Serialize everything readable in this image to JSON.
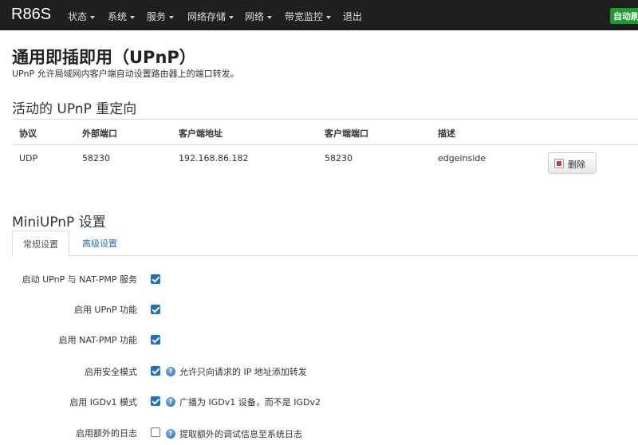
{
  "navbar": {
    "brand": "R86S",
    "items": [
      {
        "label": "状态",
        "dropdown": true
      },
      {
        "label": "系统",
        "dropdown": true
      },
      {
        "label": "服务",
        "dropdown": true
      },
      {
        "label": "网络存储",
        "dropdown": true
      },
      {
        "label": "网络",
        "dropdown": true
      },
      {
        "label": "带宽监控",
        "dropdown": true
      },
      {
        "label": "退出",
        "dropdown": false
      }
    ],
    "autorefresh": "自动刷新"
  },
  "page": {
    "title": "通用即插即用（UPnP）",
    "description": "UPnP 允许局域网内客户端自动设置路由器上的端口转发。"
  },
  "redirects": {
    "title": "活动的 UPnP 重定向",
    "columns": [
      "协议",
      "外部端口",
      "客户端地址",
      "客户端端口",
      "描述"
    ],
    "rows": [
      {
        "protocol": "UDP",
        "external_port": "58230",
        "client_address": "192.168.86.182",
        "client_port": "58230",
        "description": "edgeinside",
        "delete_label": "删除"
      }
    ]
  },
  "settings": {
    "title": "MiniUPnP 设置",
    "tabs": [
      {
        "label": "常规设置",
        "active": true
      },
      {
        "label": "高级设置",
        "active": false
      }
    ],
    "fields": [
      {
        "label": "启动 UPnP 与 NAT-PMP 服务",
        "checked": true,
        "help": ""
      },
      {
        "label": "启用 UPnP 功能",
        "checked": true,
        "help": ""
      },
      {
        "label": "启用 NAT-PMP 功能",
        "checked": true,
        "help": ""
      },
      {
        "label": "启用安全模式",
        "checked": true,
        "help": "允许只向请求的 IP 地址添加转发"
      },
      {
        "label": "启用 IGDv1 模式",
        "checked": true,
        "help": "广播为 IGDv1 设备，而不是 IGDv2"
      },
      {
        "label": "启用额外的日志",
        "checked": false,
        "help": "提取额外的调试信息至系统日志"
      }
    ]
  },
  "colors": {
    "navbar_bg": "#1f1f1f",
    "accent": "#1c6ed0",
    "autorefresh": "#1a9c2e",
    "link": "#1a6fc4"
  }
}
